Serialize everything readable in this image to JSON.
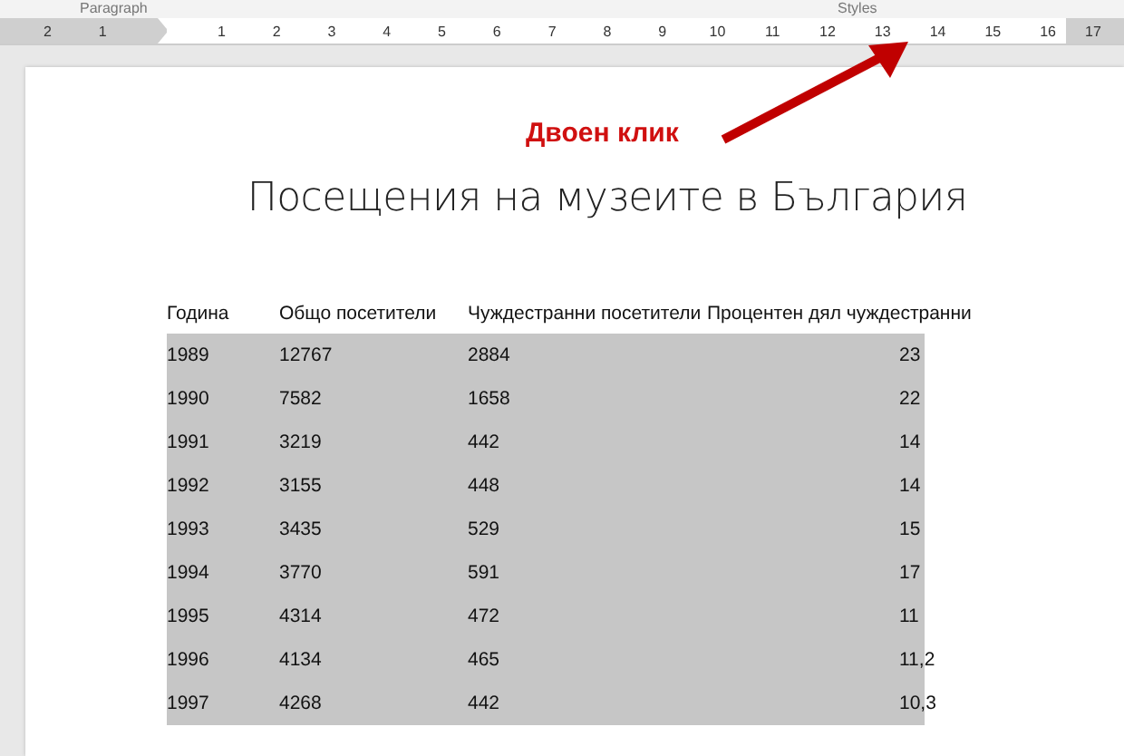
{
  "ribbon": {
    "group_labels": [
      "Paragraph",
      "Styles"
    ]
  },
  "ruler": {
    "left_numbers": [
      "2",
      "1"
    ],
    "numbers": [
      "1",
      "2",
      "3",
      "4",
      "5",
      "6",
      "7",
      "8",
      "9",
      "10",
      "11",
      "12",
      "13",
      "14",
      "15",
      "16"
    ],
    "right_numbers": [
      "17"
    ]
  },
  "annotation": {
    "text": "Двоен клик"
  },
  "document": {
    "title": "Посещения на музеите в България",
    "table": {
      "columns": [
        "Година",
        "Общо посетители",
        "Чуждестранни посетители",
        "Процентен дял чуждестранни"
      ],
      "rows": [
        [
          "1989",
          "12767",
          "2884",
          "23"
        ],
        [
          "1990",
          "7582",
          "1658",
          "22"
        ],
        [
          "1991",
          "3219",
          "442",
          "14"
        ],
        [
          "1992",
          "3155",
          "448",
          "14"
        ],
        [
          "1993",
          "3435",
          "529",
          "15"
        ],
        [
          "1994",
          "3770",
          "591",
          "17"
        ],
        [
          "1995",
          "4314",
          "472",
          "11"
        ],
        [
          "1996",
          "4134",
          "465",
          "11,2"
        ],
        [
          "1997",
          "4268",
          "442",
          "10,3"
        ]
      ]
    }
  }
}
